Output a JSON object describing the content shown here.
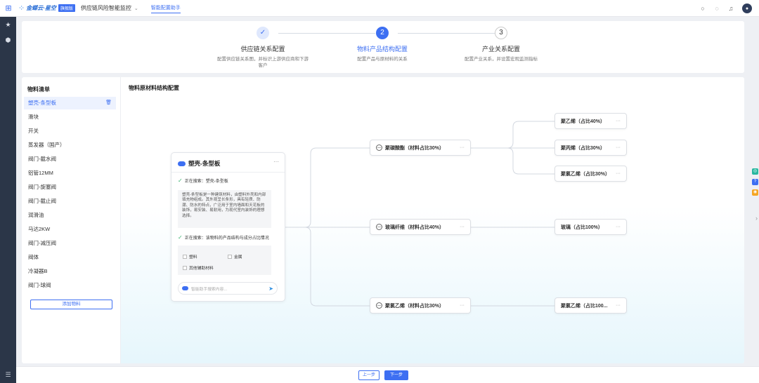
{
  "topbar": {
    "brand_name": "金蝶云·星空",
    "brand_badge": "旗舰版",
    "app_title": "供应链风险智能监控",
    "tab": "智能配置助手"
  },
  "steps": [
    {
      "num": "✓",
      "title": "供应链关系配置",
      "desc": "配置供应链关系图，并标识上游供应商和下游客户",
      "state": "done"
    },
    {
      "num": "2",
      "title": "物料产品结构配置",
      "desc": "配置产品与原材料的关系",
      "state": "active"
    },
    {
      "num": "3",
      "title": "产业关系配置",
      "desc": "配置产业关系，并设置宏观监测指标",
      "state": "todo"
    }
  ],
  "material_list": {
    "title": "物料清单",
    "items": [
      "塑壳-条型板",
      "滑块",
      "开关",
      "蒸发器（国产）",
      "阀门-截水阀",
      "铝管12MM",
      "阀门-旋塞阀",
      "阀门-截止阀",
      "润滑油",
      "马达2KW",
      "阀门-减压阀",
      "阀体",
      "冷凝器B",
      "阀门-球阀"
    ],
    "selected_index": 0,
    "add_label": "添加物料"
  },
  "canvas": {
    "title": "物料原材料结构配置"
  },
  "ai_card": {
    "name": "塑壳-条型板",
    "searching1": "正在搜索：塑壳-条型板",
    "description": "塑壳-条型板是一种建筑材料，由塑料外壳和内部填充物组成。其外观呈长条形，具有轻质、防潮、防水的特点，广泛用于室内墙面和天花板的装饰，易安装、易耐用，为现代室内装饰的理想选择。",
    "searching2": "正在搜索：该物料的产品结构与成分占比情况",
    "options": [
      "塑料",
      "金属",
      "其他辅助材料"
    ],
    "input_placeholder": "智能助手搜索内容..."
  },
  "nodes": {
    "mid": [
      {
        "label": "聚碳酸酯（材料占比30%）"
      },
      {
        "label": "玻璃纤维（材料占比40%）"
      },
      {
        "label": "聚氯乙烯（材料占比30%）"
      }
    ],
    "right": [
      {
        "label": "聚乙烯（占比40%）"
      },
      {
        "label": "聚丙烯（占比30%）"
      },
      {
        "label": "聚氯乙烯（占比30%）"
      },
      {
        "label": "玻璃（占比100%）"
      },
      {
        "label": "聚氯乙烯（占比100..."
      }
    ]
  },
  "footer": {
    "prev_label": "上一步",
    "next_label": "下一步"
  },
  "colors": {
    "accent": "#3d6ff2",
    "rail": "#2b3648",
    "check": "#3cb371"
  }
}
